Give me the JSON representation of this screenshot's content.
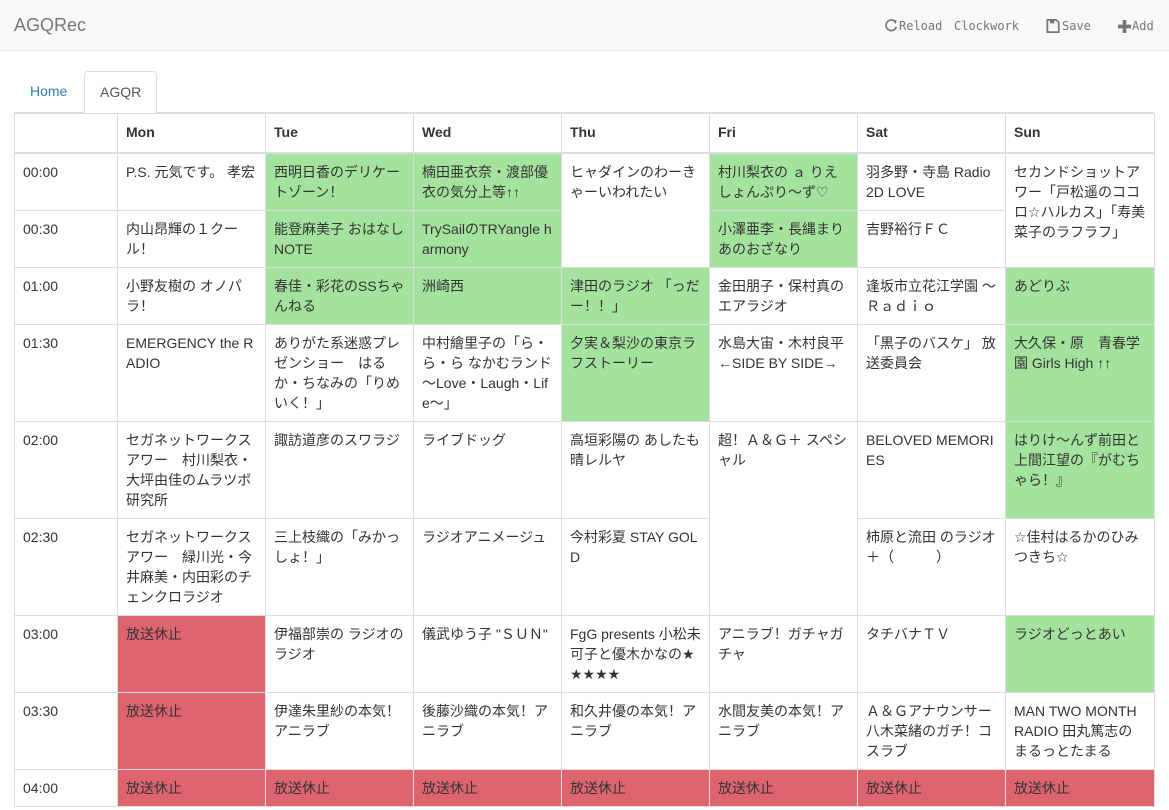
{
  "navbar": {
    "brand": "AGQRec",
    "reload": "Reload",
    "clockwork": "Clockwork",
    "save": "Save",
    "add": "Add"
  },
  "tabs": [
    "Home",
    "AGQR"
  ],
  "schedule": {
    "days": [
      "Mon",
      "Tue",
      "Wed",
      "Thu",
      "Fri",
      "Sat",
      "Sun"
    ],
    "times": [
      "00:00",
      "00:30",
      "01:00",
      "01:30",
      "02:00",
      "02:30",
      "03:00",
      "03:30",
      "04:00"
    ],
    "colors": {
      "green": "#a4e39d",
      "red": "#de6470"
    },
    "rows": [
      [
        {
          "title": "P.S. 元気です。 孝宏",
          "span": 1,
          "color": ""
        },
        {
          "title": "西明日香のデリケートゾーン！",
          "span": 1,
          "color": "green"
        },
        {
          "title": "楠田亜衣奈・渡部優衣の気分上等↑↑",
          "span": 1,
          "color": "green"
        },
        {
          "title": "ヒャダインのわーきゃーいわれたい",
          "span": 2,
          "color": ""
        },
        {
          "title": "村川梨衣の ａ りえしょんぷり～ず♡",
          "span": 1,
          "color": "green"
        },
        {
          "title": "羽多野・寺島 Radio 2D LOVE",
          "span": 1,
          "color": ""
        },
        {
          "title": "セカンドショットアワー「戸松遥のココロ☆ハルカス」「寿美菜子のラフラフ」",
          "span": 2,
          "color": ""
        }
      ],
      [
        {
          "title": "内山昂輝の１クール！",
          "span": 1,
          "color": ""
        },
        {
          "title": "能登麻美子 おはなしNOTE",
          "span": 1,
          "color": "green"
        },
        {
          "title": "TrySailのTRYangle harmony",
          "span": 1,
          "color": "green"
        },
        null,
        {
          "title": "小澤亜李・長縄まりあのおざなり",
          "span": 1,
          "color": "green"
        },
        {
          "title": "吉野裕行ＦＣ",
          "span": 1,
          "color": ""
        },
        null
      ],
      [
        {
          "title": "小野友樹の オノパラ！",
          "span": 1,
          "color": ""
        },
        {
          "title": "春佳・彩花のSSちゃんねる",
          "span": 1,
          "color": "green"
        },
        {
          "title": "洲崎西",
          "span": 1,
          "color": "green"
        },
        {
          "title": "津田のラジオ 「っだー！！」",
          "span": 1,
          "color": "green"
        },
        {
          "title": "金田朋子・保村真のエアラジオ",
          "span": 1,
          "color": ""
        },
        {
          "title": "逢坂市立花江学園 ～ Ｒａｄｉｏ",
          "span": 1,
          "color": ""
        },
        {
          "title": "あどりぶ",
          "span": 1,
          "color": "green"
        }
      ],
      [
        {
          "title": "EMERGENCY the RADIO",
          "span": 1,
          "color": ""
        },
        {
          "title": "ありがた系迷惑プレゼンショー　はるか・ちなみの「りめいく！」",
          "span": 1,
          "color": ""
        },
        {
          "title": "中村繪里子の「ら・ら・ら なかむランド～Love・Laugh・Life～」",
          "span": 1,
          "color": ""
        },
        {
          "title": "夕実＆梨沙の東京ラフストーリー",
          "span": 1,
          "color": "green"
        },
        {
          "title": "水島大宙・木村良平 ←SIDE BY SIDE→",
          "span": 1,
          "color": ""
        },
        {
          "title": "「黒子のバスケ」 放送委員会",
          "span": 1,
          "color": ""
        },
        {
          "title": "大久保・原　青春学園 Girls High ↑↑",
          "span": 1,
          "color": "green"
        }
      ],
      [
        {
          "title": "セガネットワークスアワー　村川梨衣・大坪由佳のムラツボ研究所",
          "span": 1,
          "color": ""
        },
        {
          "title": "諏訪道彦のスワラジ",
          "span": 1,
          "color": ""
        },
        {
          "title": "ライブドッグ",
          "span": 1,
          "color": ""
        },
        {
          "title": "高垣彩陽の あしたも晴レルヤ",
          "span": 1,
          "color": ""
        },
        {
          "title": "超！Ａ＆Ｇ＋ スペシャル",
          "span": 2,
          "color": ""
        },
        {
          "title": "BELOVED MEMORIES",
          "span": 1,
          "color": ""
        },
        {
          "title": "はりけ～んず前田と上間江望の『がむちゃら！』",
          "span": 1,
          "color": "green"
        }
      ],
      [
        {
          "title": "セガネットワークスアワー　緑川光・今井麻美・内田彩のチェンクロラジオ",
          "span": 1,
          "color": ""
        },
        {
          "title": "三上枝織の「みかっしょ！」",
          "span": 1,
          "color": ""
        },
        {
          "title": "ラジオアニメージュ",
          "span": 1,
          "color": ""
        },
        {
          "title": "今村彩夏 STAY GOLD",
          "span": 1,
          "color": ""
        },
        null,
        {
          "title": "柿原と流田 のラジオ＋（　　　）",
          "span": 1,
          "color": ""
        },
        {
          "title": "☆佳村はるかのひみつきち☆",
          "span": 1,
          "color": ""
        }
      ],
      [
        {
          "title": "放送休止",
          "span": 1,
          "color": "red"
        },
        {
          "title": "伊福部崇の ラジオのラジオ",
          "span": 1,
          "color": ""
        },
        {
          "title": "儀武ゆう子 \"ＳＵＮ\"",
          "span": 1,
          "color": ""
        },
        {
          "title": "FgG presents 小松未可子と優木かなの★★★★★",
          "span": 1,
          "color": ""
        },
        {
          "title": "アニラブ！ガチャガチャ",
          "span": 1,
          "color": ""
        },
        {
          "title": "タチバナＴＶ",
          "span": 1,
          "color": ""
        },
        {
          "title": "ラジオどっとあい",
          "span": 1,
          "color": "green"
        }
      ],
      [
        {
          "title": "放送休止",
          "span": 1,
          "color": "red"
        },
        {
          "title": "伊達朱里紗の本気！アニラブ",
          "span": 1,
          "color": ""
        },
        {
          "title": "後藤沙織の本気！アニラブ",
          "span": 1,
          "color": ""
        },
        {
          "title": "和久井優の本気！アニラブ",
          "span": 1,
          "color": ""
        },
        {
          "title": "水間友美の本気！アニラブ",
          "span": 1,
          "color": ""
        },
        {
          "title": "Ａ＆Ｇアナウンサー八木菜緒のガチ！コスラブ",
          "span": 1,
          "color": ""
        },
        {
          "title": "MAN TWO MONTH RADIO 田丸篤志のまるっとたまる",
          "span": 1,
          "color": ""
        }
      ],
      [
        {
          "title": "放送休止",
          "span": 1,
          "color": "red"
        },
        {
          "title": "放送休止",
          "span": 1,
          "color": "red"
        },
        {
          "title": "放送休止",
          "span": 1,
          "color": "red"
        },
        {
          "title": "放送休止",
          "span": 1,
          "color": "red"
        },
        {
          "title": "放送休止",
          "span": 1,
          "color": "red"
        },
        {
          "title": "放送休止",
          "span": 1,
          "color": "red"
        },
        {
          "title": "放送休止",
          "span": 1,
          "color": "red"
        }
      ]
    ]
  }
}
